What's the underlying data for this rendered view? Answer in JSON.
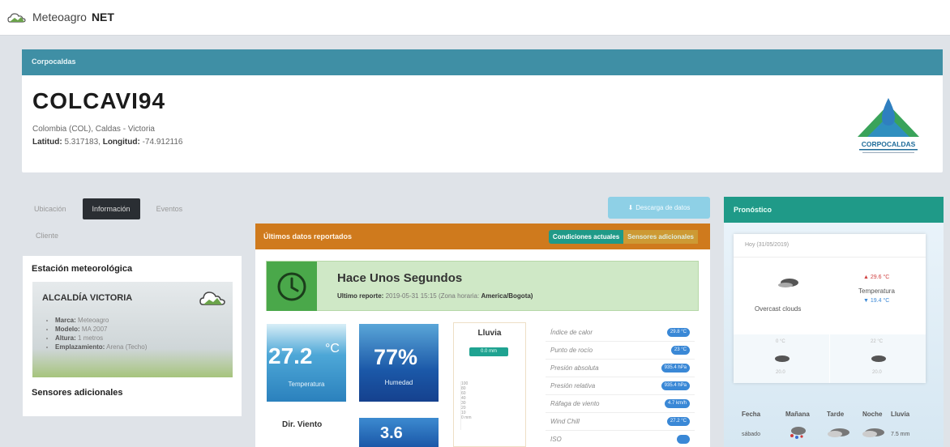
{
  "brand": {
    "prefix": "Meteoagro",
    "suffix": "NET"
  },
  "station": {
    "header": "Corpocaldas",
    "id": "COLCAVI94",
    "location": "Colombia (COL), Caldas - Victoria",
    "lat_label": "Latitud:",
    "lat_value": "5.317183,",
    "lon_label": "Longitud:",
    "lon_value": "-74.912116",
    "logo_text": "CORPOCALDAS"
  },
  "tabs": [
    {
      "label": "Ubicación",
      "active": false
    },
    {
      "label": "Información",
      "active": true
    },
    {
      "label": "Eventos",
      "active": false
    }
  ],
  "tab_sub": "Cliente",
  "left": {
    "title": "Estación meteorológica",
    "photo_name": "ALCALDÍA VICTORIA",
    "items": [
      {
        "key": "Marca:",
        "val": "Meteoagro"
      },
      {
        "key": "Modelo:",
        "val": "MA 2007"
      },
      {
        "key": "Altura:",
        "val": "1 metros"
      },
      {
        "key": "Emplazamiento:",
        "val": "Arena (Techo)"
      }
    ],
    "subtitle": "Sensores adicionales"
  },
  "download_label": "Descarga de datos",
  "panel": {
    "title": "Últimos datos reportados",
    "toggle_active": "Condiciones actuales",
    "toggle_other": "Sensores adicionales"
  },
  "report": {
    "title": "Hace Unos Segundos",
    "meta_label": "Ultimo reporte:",
    "meta_value": "2019-05-31 15:15 (Zona horaria:",
    "meta_zone": "America/Bogota)"
  },
  "temperature": {
    "value": "27.2",
    "unit": "°C",
    "caption": "Temperatura"
  },
  "humidity": {
    "value": "77%",
    "caption": "Humedad"
  },
  "rain": {
    "title": "Lluvia",
    "value": "0.0 mm",
    "axis": [
      "100",
      "80",
      "60",
      "40",
      "30",
      "20",
      "10",
      "0 mm"
    ]
  },
  "sensors": [
    {
      "label": "Índice de calor",
      "value": "29.8 °C"
    },
    {
      "label": "Punto de rocío",
      "value": "23 °C"
    },
    {
      "label": "Presión absoluta",
      "value": "935.4 hPa"
    },
    {
      "label": "Presión relativa",
      "value": "935.4 hPa"
    },
    {
      "label": "Ráfaga de viento",
      "value": "4.7 km/h"
    },
    {
      "label": "Wind Chill",
      "value": "27.2 °C"
    },
    {
      "label": "ISO",
      "value": ""
    }
  ],
  "wind": {
    "direction_label": "Dir. Viento",
    "speed_value": "3.6"
  },
  "forecast": {
    "header": "Pronóstico",
    "date": "Hoy (31/05/2019)",
    "condition": "Overcast clouds",
    "max": "▲ 29.6 °C",
    "temp_label": "Temperatura",
    "min": "▼ 19.4 °C",
    "small": [
      "0 °C",
      "22 °C",
      "20.0",
      "20.0"
    ],
    "table_headers": [
      "Fecha",
      "Mañana",
      "Tarde",
      "Noche",
      "Lluvia"
    ],
    "row_date": "sábado",
    "row_rain": "7.5 mm"
  }
}
